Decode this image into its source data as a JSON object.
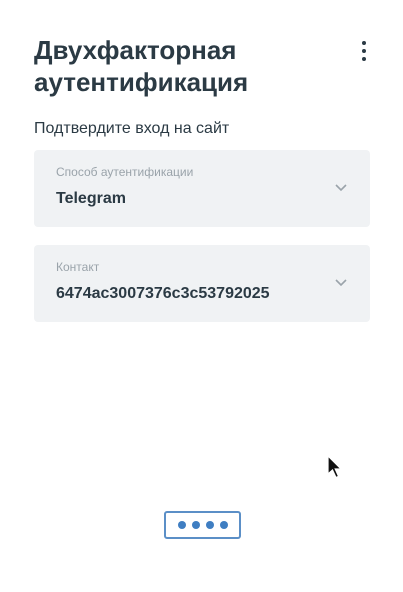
{
  "header": {
    "title": "Двухфакторная аутентификация",
    "menu_icon": "more-vertical-icon"
  },
  "subtitle": "Подтвердите вход на сайт",
  "method_select": {
    "label": "Способ аутентификации",
    "value": "Telegram",
    "icon": "chevron-down-icon"
  },
  "contact_select": {
    "label": "Контакт",
    "value": "6474ac3007376c3c53792025",
    "icon": "chevron-down-icon"
  },
  "loader": {
    "icon": "loading-dots-icon",
    "dots": 4,
    "color": "#3f7ec2"
  },
  "colors": {
    "text": "#2b3a44",
    "field_bg": "#f0f2f4",
    "label": "#9aa3aa",
    "accent": "#3f7ec2"
  }
}
